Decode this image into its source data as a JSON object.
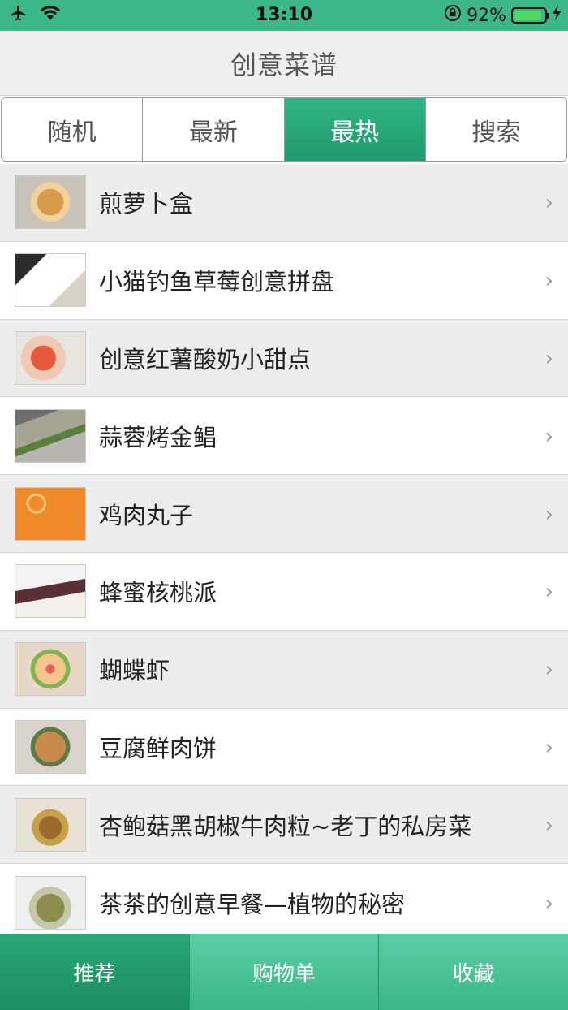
{
  "status_bar": {
    "time": "13:10",
    "battery_percent": "92%",
    "battery_level": 0.92,
    "icons": [
      "airplane-icon",
      "wifi-icon",
      "rotation-lock-icon",
      "battery-icon",
      "charging-icon"
    ]
  },
  "nav": {
    "title": "创意菜谱"
  },
  "segments": [
    {
      "label": "随机"
    },
    {
      "label": "最新"
    },
    {
      "label": "最热"
    },
    {
      "label": "搜索"
    }
  ],
  "active_segment": 2,
  "recipes": [
    {
      "title": "煎萝卜盒"
    },
    {
      "title": "小猫钓鱼草莓创意拼盘"
    },
    {
      "title": "创意红薯酸奶小甜点"
    },
    {
      "title": "蒜蓉烤金鲳"
    },
    {
      "title": "鸡肉丸子"
    },
    {
      "title": "蜂蜜核桃派"
    },
    {
      "title": "蝴蝶虾"
    },
    {
      "title": "豆腐鲜肉饼"
    },
    {
      "title": "杏鲍菇黑胡椒牛肉粒~老丁的私房菜"
    },
    {
      "title": "茶茶的创意早餐—植物的秘密"
    }
  ],
  "chevron": "›",
  "tabs": [
    {
      "label": "推荐"
    },
    {
      "label": "购物单"
    },
    {
      "label": "收藏"
    }
  ],
  "active_tab": 0,
  "colors": {
    "accent": "#2aa877",
    "status_bar": "#3cb888"
  }
}
